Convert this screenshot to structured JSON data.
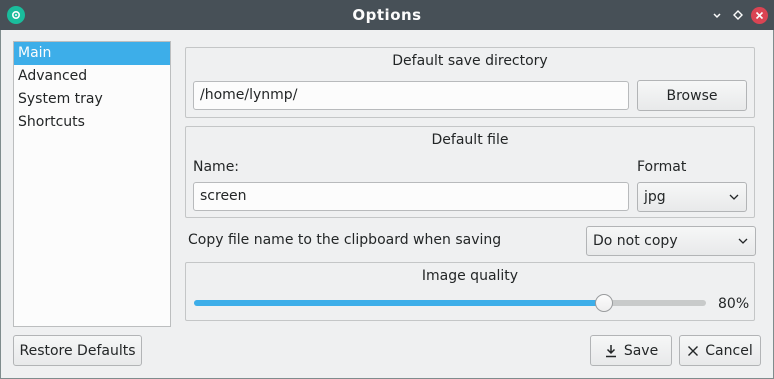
{
  "window": {
    "title": "Options"
  },
  "sidebar": {
    "items": [
      {
        "label": "Main",
        "selected": true
      },
      {
        "label": "Advanced",
        "selected": false
      },
      {
        "label": "System tray",
        "selected": false
      },
      {
        "label": "Shortcuts",
        "selected": false
      }
    ]
  },
  "save_directory": {
    "title": "Default save directory",
    "path_value": "/home/lynmp/",
    "browse_label": "Browse"
  },
  "default_file": {
    "title": "Default file",
    "name_label": "Name:",
    "name_value": "screen",
    "format_label": "Format",
    "format_value": "jpg"
  },
  "clipboard": {
    "label": "Copy file name to the clipboard when saving",
    "value": "Do not copy"
  },
  "image_quality": {
    "title": "Image quality",
    "value_percent": 80,
    "value_text": "80%"
  },
  "footer": {
    "restore_label": "Restore Defaults",
    "save_label": "Save",
    "cancel_label": "Cancel"
  },
  "colors": {
    "accent": "#3daee9",
    "titlebar": "#475057",
    "close": "#da4453"
  }
}
